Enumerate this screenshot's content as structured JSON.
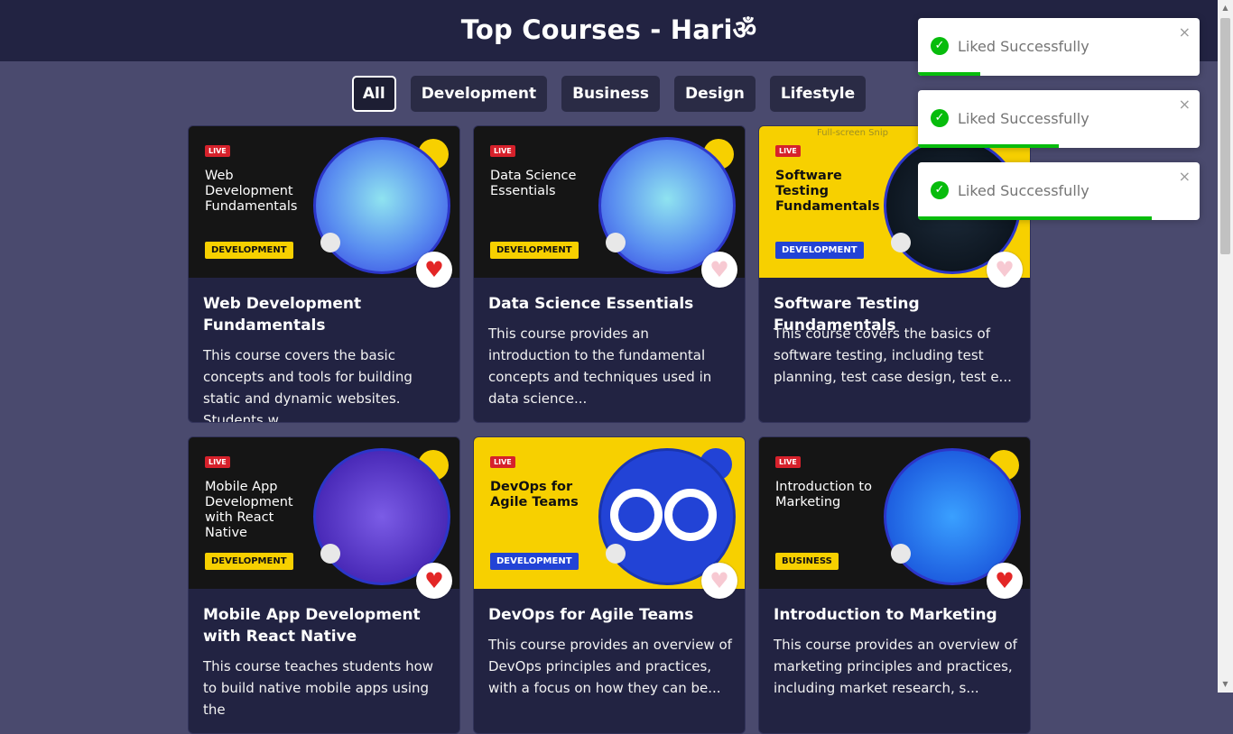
{
  "header": {
    "title": "Top Courses - Hariॐ"
  },
  "filters": [
    {
      "label": "All",
      "active": true
    },
    {
      "label": "Development",
      "active": false
    },
    {
      "label": "Business",
      "active": false
    },
    {
      "label": "Design",
      "active": false
    },
    {
      "label": "Lifestyle",
      "active": false
    }
  ],
  "live_badge": "LIVE",
  "courses": [
    {
      "thumb_title": "Web Development Fundamentals",
      "tag": "DEVELOPMENT",
      "title": "Web Development Fundamentals",
      "description": "This course covers the basic concepts and tools for building static and dynamic websites. Students w...",
      "liked": true,
      "illustration": "developer-illustration"
    },
    {
      "thumb_title": "Data Science Essentials",
      "tag": "DEVELOPMENT",
      "title": "Data Science Essentials",
      "description": "This course provides an introduction to the fundamental concepts and techniques used in data science...",
      "liked": false,
      "illustration": "developer-illustration"
    },
    {
      "thumb_title": "Software Testing Fundamentals",
      "tag": "DEVELOPMENT",
      "title": "Software Testing Fundamentals",
      "description": "This course covers the basics of software testing, including test planning, test case design, test e...",
      "liked": false,
      "illustration": "code-screen-illustration"
    },
    {
      "thumb_title": "Mobile App Development with React Native",
      "tag": "DEVELOPMENT",
      "title": "Mobile App Development with React Native",
      "description": "This course teaches students how to build native mobile apps using the",
      "liked": true,
      "illustration": "code-brackets-illustration"
    },
    {
      "thumb_title": "DevOps for Agile Teams",
      "tag": "DEVELOPMENT",
      "title": "DevOps for Agile Teams",
      "description": "This course provides an overview of DevOps principles and practices, with a focus on how they can be...",
      "liked": false,
      "illustration": "devops-loop-illustration"
    },
    {
      "thumb_title": "Introduction to Marketing",
      "tag": "BUSINESS",
      "title": "Introduction to Marketing",
      "description": "This course provides an overview of marketing principles and practices, including market research, s...",
      "liked": true,
      "illustration": "marketing-illustration"
    }
  ],
  "toasts": [
    {
      "message": "Liked Successfully",
      "close": "×",
      "progress": 0.22
    },
    {
      "message": "Liked Successfully",
      "close": "×",
      "progress": 0.5
    },
    {
      "message": "Liked Successfully",
      "close": "×",
      "progress": 0.83
    }
  ],
  "snip_hint": "Full-screen Snip",
  "icons": {
    "heart": "♥",
    "check": "✓"
  },
  "colors": {
    "background": "#4a4a6e",
    "navbar": "#222342",
    "card": "#222342",
    "liked": "#e32626",
    "unliked": "#f7c9d2",
    "toast_success": "#07bc0c"
  }
}
